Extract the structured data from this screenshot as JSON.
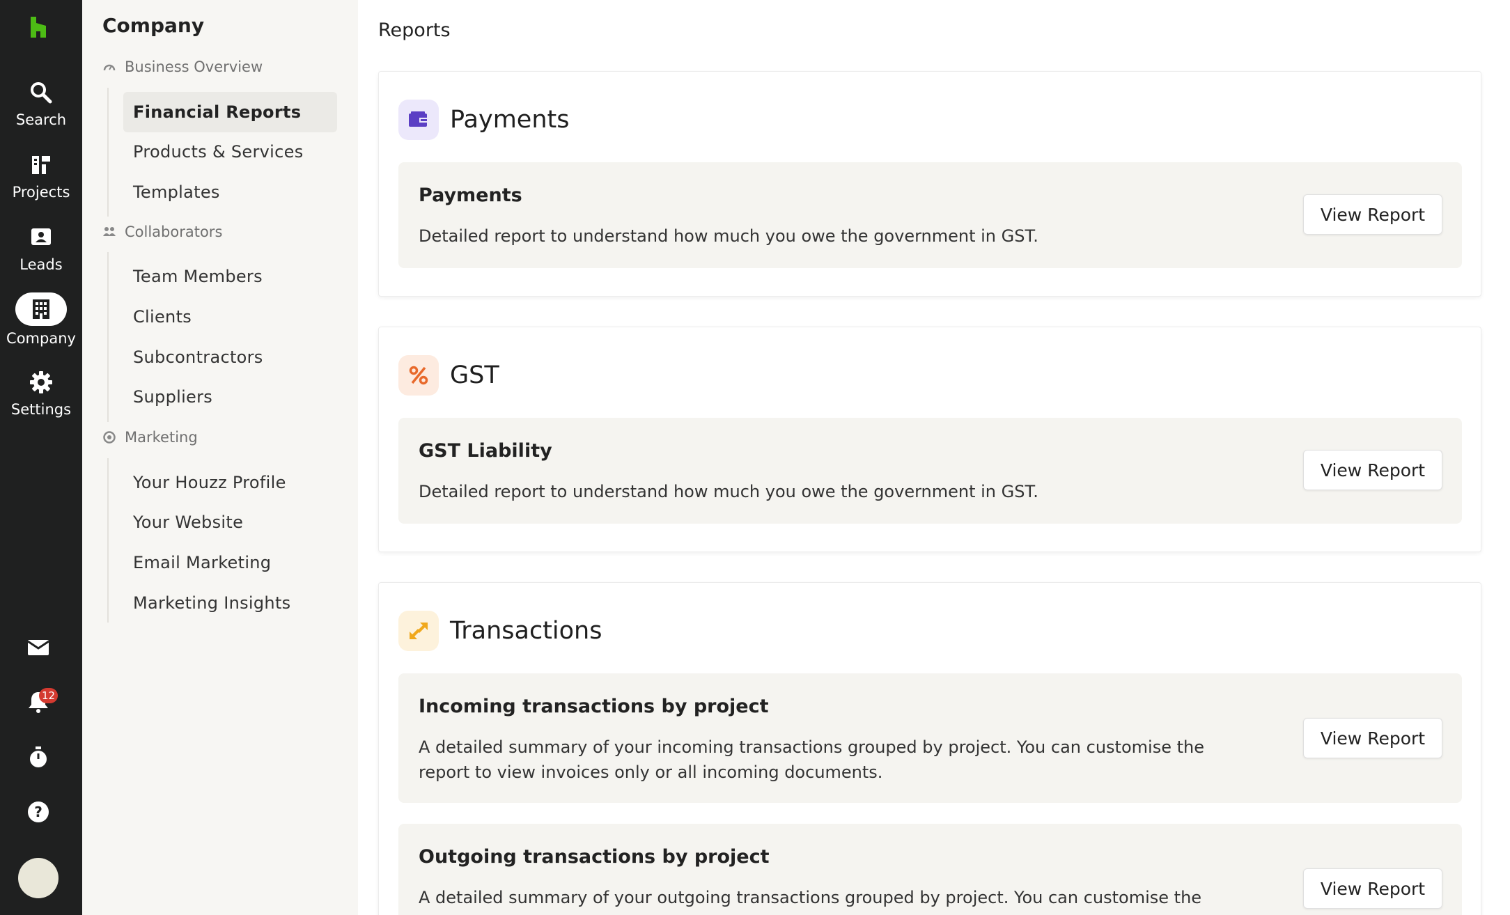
{
  "rail": {
    "items": [
      {
        "label": "Search",
        "icon": "search-icon"
      },
      {
        "label": "Projects",
        "icon": "projects-icon"
      },
      {
        "label": "Leads",
        "icon": "leads-icon"
      },
      {
        "label": "Company",
        "icon": "company-icon"
      },
      {
        "label": "Settings",
        "icon": "gear-icon"
      }
    ],
    "notification_count": "12"
  },
  "sidebar": {
    "title": "Company",
    "groups": [
      {
        "label": "Business Overview",
        "items": [
          "Financial Reports",
          "Products & Services",
          "Templates"
        ]
      },
      {
        "label": "Collaborators",
        "items": [
          "Team Members",
          "Clients",
          "Subcontractors",
          "Suppliers"
        ]
      },
      {
        "label": "Marketing",
        "items": [
          "Your Houzz Profile",
          "Your Website",
          "Email Marketing",
          "Marketing Insights"
        ]
      }
    ],
    "active_item": "Financial Reports"
  },
  "main": {
    "page_title": "Reports",
    "button_label": "View Report",
    "sections": [
      {
        "title": "Payments",
        "icon": "wallet-icon",
        "icon_color": "#5b3fc4",
        "icon_bg": "#ece8fb",
        "reports": [
          {
            "name": "Payments",
            "desc": "Detailed report to understand how much you owe the government in GST."
          }
        ]
      },
      {
        "title": "GST",
        "icon": "percent-icon",
        "icon_color": "#e8692b",
        "icon_bg": "#fdebe0",
        "reports": [
          {
            "name": "GST Liability",
            "desc": "Detailed report to understand how much you owe the government in GST."
          }
        ]
      },
      {
        "title": "Transactions",
        "icon": "arrows-icon",
        "icon_color": "#f0a81c",
        "icon_bg": "#fdf2dc",
        "reports": [
          {
            "name": "Incoming transactions by project",
            "desc": "A detailed summary of your incoming transactions grouped by project. You can customise the report to view invoices only or all incoming documents."
          },
          {
            "name": "Outgoing transactions by project",
            "desc": "A detailed summary of your outgoing transactions grouped by project. You can customise the report to"
          }
        ]
      }
    ]
  }
}
